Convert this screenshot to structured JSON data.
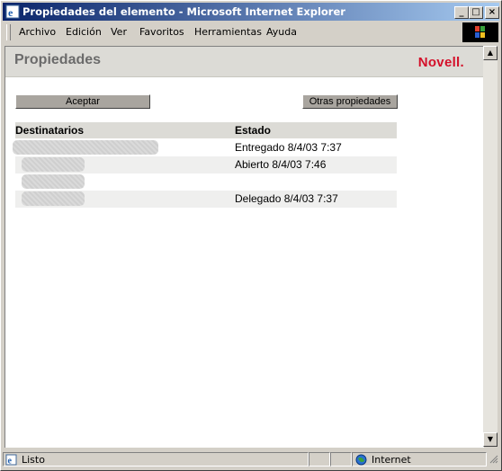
{
  "window": {
    "title": "Propiedades del elemento - Microsoft Internet Explorer",
    "buttons": {
      "minimize": "_",
      "maximize": "□",
      "close": "×"
    }
  },
  "menu": [
    "Archivo",
    "Edición",
    "Ver",
    "Favoritos",
    "Herramientas",
    "Ayuda"
  ],
  "page": {
    "title": "Propiedades",
    "brand": "Novell.",
    "accept_button": "Aceptar",
    "other_properties_button": "Otras propiedades"
  },
  "table": {
    "headers": {
      "recipients": "Destinatarios",
      "status": "Estado"
    },
    "rows": [
      {
        "recipient": "",
        "status": "Entregado 8/4/03 7:37"
      },
      {
        "recipient": "",
        "status": "Abierto 8/4/03 7:46"
      },
      {
        "recipient": "",
        "status": ""
      },
      {
        "recipient": "",
        "status": "Delegado 8/4/03 7:37"
      }
    ]
  },
  "status_bar": {
    "left": "Listo",
    "zone": "Internet"
  },
  "colors": {
    "title_bar": "#0a246a",
    "brand": "#d4102a",
    "page_header_bg": "#dcdbd6"
  }
}
